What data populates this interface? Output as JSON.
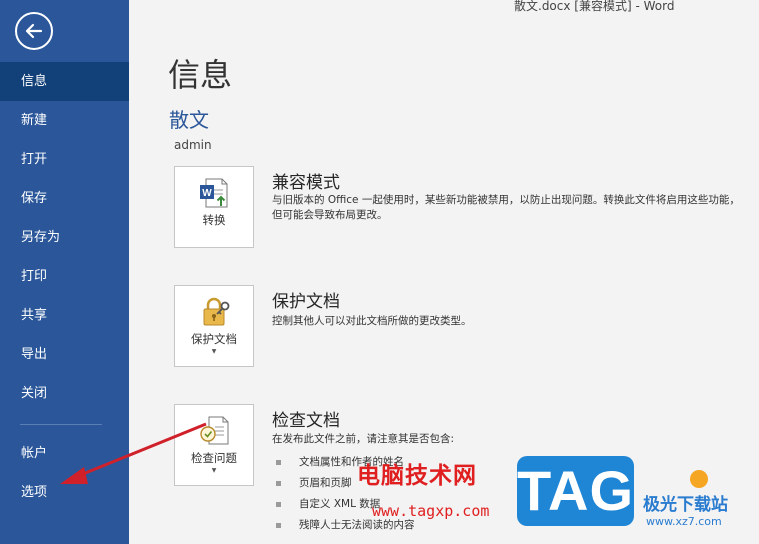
{
  "window": {
    "title": "散文.docx [兼容模式] - Word"
  },
  "sidebar": {
    "items": [
      {
        "label": "信息",
        "active": true
      },
      {
        "label": "新建"
      },
      {
        "label": "打开"
      },
      {
        "label": "保存"
      },
      {
        "label": "另存为"
      },
      {
        "label": "打印"
      },
      {
        "label": "共享"
      },
      {
        "label": "导出"
      },
      {
        "label": "关闭"
      }
    ],
    "lower_items": [
      {
        "label": "帐户"
      },
      {
        "label": "选项"
      }
    ],
    "back_icon": "back-arrow-icon",
    "color": "#2b579a",
    "active_color": "#124078"
  },
  "main": {
    "page_title": "信息",
    "doc_name": "散文",
    "author": "admin",
    "sections": [
      {
        "button_label": "转换",
        "icon": "word-convert-icon",
        "title": "兼容模式",
        "description": "与旧版本的 Office 一起使用时，某些新功能被禁用，以防止出现问题。转换此文件将启用这些功能，但可能会导致布局更改。"
      },
      {
        "button_label": "保护文档",
        "icon": "lock-key-icon",
        "title": "保护文档",
        "description": "控制其他人可以对此文档所做的更改类型。"
      },
      {
        "button_label": "检查问题",
        "icon": "inspect-document-icon",
        "title": "检查文档",
        "description": "在发布此文件之前，请注意其是否包含:",
        "bullets": [
          "文档属性和作者的姓名",
          "页眉和页脚",
          "自定义 XML 数据",
          "残障人士无法阅读的内容"
        ]
      }
    ]
  },
  "overlay": {
    "watermark_cn": "电脑技术网",
    "watermark_url": "www.tagxp.com",
    "watermark_tag": "TAG",
    "watermark_site": "极光下载站",
    "watermark_site_url": "www.xz7.com",
    "arrow_color": "#d0202a"
  }
}
